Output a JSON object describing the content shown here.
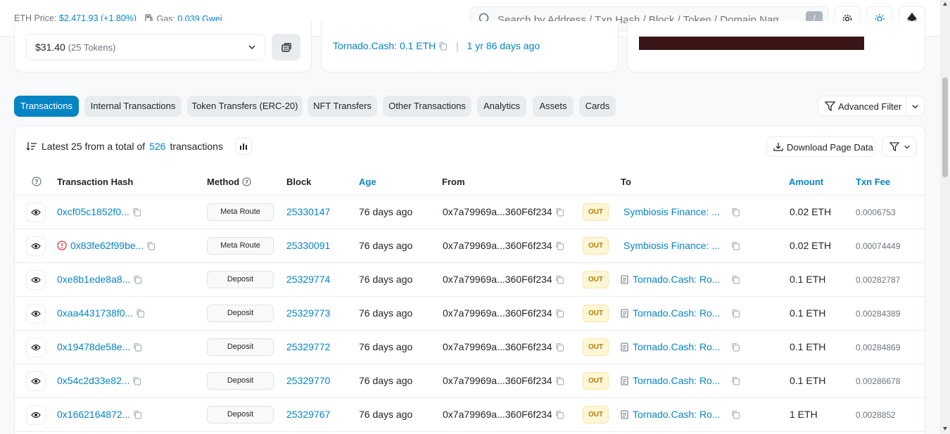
{
  "header": {
    "eth_price_label": "ETH Price:",
    "eth_price_value": "$2,471.93 (+1.80%)",
    "gas_label": "Gas:",
    "gas_value": "0.039 Gwei",
    "search_placeholder": "Search by Address / Txn Hash / Block / Token / Domain Name",
    "search_shortcut": "/"
  },
  "overview": {
    "token_value": "$31.40",
    "token_count": "(25 Tokens)",
    "funded_by": "Tornado.Cash: 0.1 ETH",
    "funded_age": "1 yr 86 days ago"
  },
  "tabs": [
    "Transactions",
    "Internal Transactions",
    "Token Transfers (ERC-20)",
    "NFT Transfers",
    "Other Transactions",
    "Analytics",
    "Assets",
    "Cards"
  ],
  "advanced_filter": "Advanced Filter",
  "summary": {
    "prefix": "Latest 25 from a total of",
    "count": "526",
    "suffix": "transactions"
  },
  "download_label": "Download Page Data",
  "columns": {
    "hash": "Transaction Hash",
    "method": "Method",
    "block": "Block",
    "age": "Age",
    "from": "From",
    "to": "To",
    "amount": "Amount",
    "fee": "Txn Fee"
  },
  "rows": [
    {
      "hash": "0xcf05c1852f0...",
      "method": "Meta Route",
      "block": "25330147",
      "age": "76 days ago",
      "from": "0x7a79969a...360F6f234",
      "dir": "OUT",
      "to": "Symbiosis Finance: ...",
      "amount": "0.02 ETH",
      "fee": "0.0006753"
    },
    {
      "hash": "0x83fe62f99be...",
      "method": "Meta Route",
      "block": "25330091",
      "age": "76 days ago",
      "from": "0x7a79969a...360F6f234",
      "dir": "OUT",
      "to": "Symbiosis Finance: ...",
      "amount": "0.02 ETH",
      "fee": "0.00074449"
    },
    {
      "hash": "0xe8b1ede8a8...",
      "method": "Deposit",
      "block": "25329774",
      "age": "76 days ago",
      "from": "0x7a79969a...360F6f234",
      "dir": "OUT",
      "to": "Tornado.Cash: Ro...",
      "amount": "0.1 ETH",
      "fee": "0.00282787"
    },
    {
      "hash": "0xaa4431738f0...",
      "method": "Deposit",
      "block": "25329773",
      "age": "76 days ago",
      "from": "0x7a79969a...360F6f234",
      "dir": "OUT",
      "to": "Tornado.Cash: Ro...",
      "amount": "0.1 ETH",
      "fee": "0.00284389"
    },
    {
      "hash": "0x19478de58e...",
      "method": "Deposit",
      "block": "25329772",
      "age": "76 days ago",
      "from": "0x7a79969a...360F6f234",
      "dir": "OUT",
      "to": "Tornado.Cash: Ro...",
      "amount": "0.1 ETH",
      "fee": "0.00284869"
    },
    {
      "hash": "0x54c2d33e82...",
      "method": "Deposit",
      "block": "25329770",
      "age": "76 days ago",
      "from": "0x7a79969a...360F6f234",
      "dir": "OUT",
      "to": "Tornado.Cash: Ro...",
      "amount": "0.1 ETH",
      "fee": "0.00286678"
    },
    {
      "hash": "0x1662164872...",
      "method": "Deposit",
      "block": "25329767",
      "age": "76 days ago",
      "from": "0x7a79969a...360F6f234",
      "dir": "OUT",
      "to": "Tornado.Cash: Ro...",
      "amount": "1 ETH",
      "fee": "0.0028852"
    }
  ],
  "colors": {
    "accent": "#0784c3",
    "out_badge": "#fef6d5",
    "error": "#dc3545"
  }
}
